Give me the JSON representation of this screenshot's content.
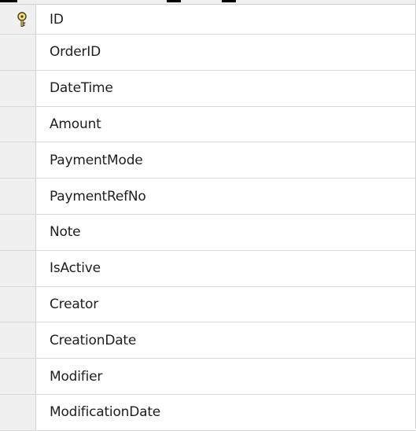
{
  "table": {
    "columns": [
      {
        "name": "ID",
        "primary_key": true,
        "icon": "key-icon"
      },
      {
        "name": "OrderID"
      },
      {
        "name": "DateTime"
      },
      {
        "name": "Amount"
      },
      {
        "name": "PaymentMode"
      },
      {
        "name": "PaymentRefNo"
      },
      {
        "name": "Note"
      },
      {
        "name": "IsActive"
      },
      {
        "name": "Creator"
      },
      {
        "name": "CreationDate"
      },
      {
        "name": "Modifier"
      },
      {
        "name": "ModificationDate"
      }
    ]
  },
  "colors": {
    "selector_bg": "#f0f0f0",
    "row_divider": "#d8d8d8",
    "text": "#1e1e1e",
    "key_fill": "#f5e37a",
    "key_stroke": "#4a3c10"
  }
}
